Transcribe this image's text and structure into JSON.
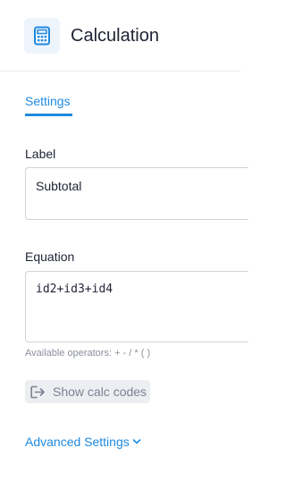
{
  "header": {
    "title": "Calculation",
    "icon": "calculator-icon",
    "icon_color": "#1f8ae0"
  },
  "tabs": [
    {
      "label": "Settings",
      "active": true
    }
  ],
  "fields": {
    "label": {
      "label": "Label",
      "value": "Subtotal"
    },
    "equation": {
      "label": "Equation",
      "value": "id2+id3+id4",
      "helper": "Available operators: + - / * ( )"
    }
  },
  "calc_codes_button": {
    "label": "Show calc codes",
    "icon": "sign-out-icon"
  },
  "advanced_settings": {
    "label": "Advanced Settings",
    "icon": "chevron-down-icon"
  },
  "colors": {
    "accent": "#1f8ae0",
    "text": "#1e2233",
    "muted": "#8a8f9c",
    "border": "#cfd3db"
  }
}
